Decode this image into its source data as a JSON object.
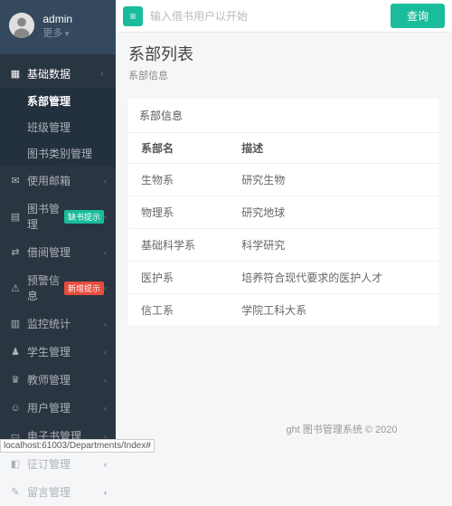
{
  "user": {
    "name": "admin",
    "more": "更多"
  },
  "sidebar": {
    "items": [
      {
        "ic": "▦",
        "label": "基础数据",
        "open": true,
        "sub": [
          {
            "label": "系部管理",
            "active": true
          },
          {
            "label": "班级管理"
          },
          {
            "label": "图书类别管理"
          }
        ]
      },
      {
        "ic": "✉",
        "label": "使用邮箱"
      },
      {
        "ic": "▤",
        "label": "图书管理",
        "badge": "缺书提示",
        "badgeCls": "bg-green"
      },
      {
        "ic": "⇄",
        "label": "借阅管理"
      },
      {
        "ic": "⚠",
        "label": "预警信息",
        "badge": "新增提示",
        "badgeCls": "bg-red"
      },
      {
        "ic": "▥",
        "label": "监控统计"
      },
      {
        "ic": "♟",
        "label": "学生管理"
      },
      {
        "ic": "♛",
        "label": "教师管理"
      },
      {
        "ic": "☺",
        "label": "用户管理"
      },
      {
        "ic": "▭",
        "label": "电子书管理"
      },
      {
        "ic": "◧",
        "label": "征订管理"
      },
      {
        "ic": "✎",
        "label": "留言管理"
      }
    ]
  },
  "topbar": {
    "placeholder": "输入借书用户以开始",
    "query": "查询"
  },
  "page": {
    "title": "系部列表",
    "crumb": "系部信息"
  },
  "panel": {
    "title": "系部信息"
  },
  "table": {
    "cols": [
      "系部名",
      "描述"
    ],
    "rows": [
      [
        "生物系",
        "研究生物"
      ],
      [
        "物理系",
        "研究地球"
      ],
      [
        "基础科学系",
        "科学研究"
      ],
      [
        "医护系",
        "培养符合现代要求的医护人才"
      ],
      [
        "信工系",
        "学院工科大系"
      ]
    ]
  },
  "footer": "ght 图书管理系统 © 2020",
  "status_url": "localhost:61003/Departments/Index#"
}
